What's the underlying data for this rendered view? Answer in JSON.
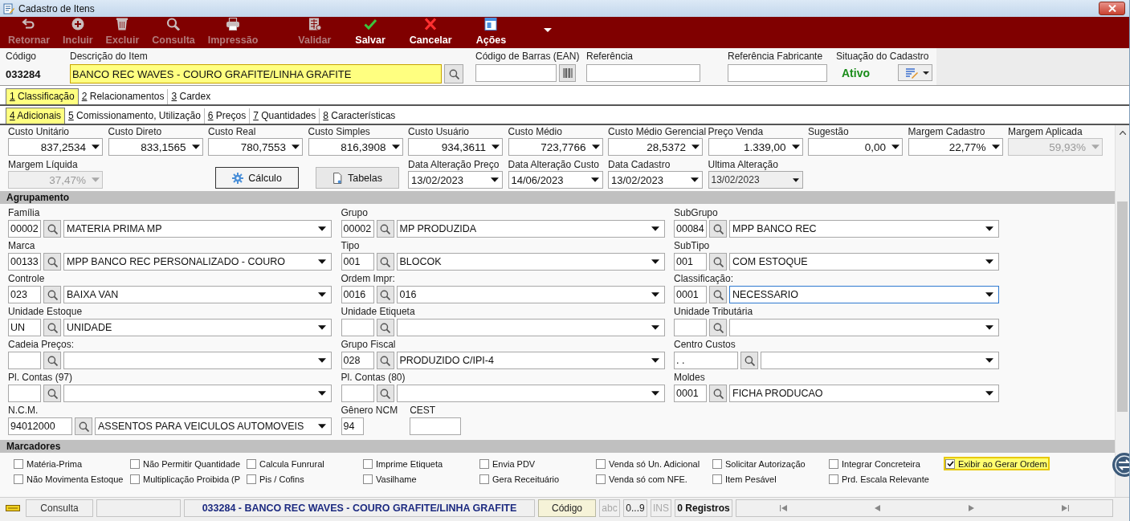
{
  "window": {
    "title": "Cadastro de Itens"
  },
  "toolbar": {
    "groups": [
      [
        {
          "label": "Retornar",
          "kind": "return",
          "disabled": true
        },
        {
          "label": "Incluir",
          "kind": "add",
          "disabled": true
        },
        {
          "label": "Excluir",
          "kind": "delete",
          "disabled": true
        },
        {
          "label": "Consulta",
          "kind": "search",
          "disabled": true
        },
        {
          "label": "Impressão",
          "kind": "print",
          "disabled": true
        }
      ],
      [
        {
          "label": "Validar",
          "kind": "validate",
          "disabled": true
        },
        {
          "label": "Salvar",
          "kind": "save",
          "disabled": false
        },
        {
          "label": "Cancelar",
          "kind": "cancel",
          "disabled": false
        },
        {
          "label": "Ações",
          "kind": "actions",
          "disabled": false
        }
      ]
    ]
  },
  "header": {
    "code": {
      "label": "Código",
      "value": "033284"
    },
    "description": {
      "label": "Descrição do Item",
      "value": "BANCO REC WAVES - COURO GRAFITE/LINHA GRAFITE",
      "highlighted": true
    },
    "barcode": {
      "label": "Código de Barras (EAN)"
    },
    "reference": {
      "label": "Referência"
    },
    "manufacturer_reference": {
      "label": "Referência Fabricante"
    },
    "status": {
      "label": "Situação do Cadastro",
      "value": "Ativo"
    }
  },
  "tabs": [
    {
      "key": "1",
      "label": "Classificação",
      "selected": true
    },
    {
      "key": "2",
      "label": "Relacionamentos",
      "selected": false
    },
    {
      "key": "3",
      "label": "Cardex",
      "selected": false
    }
  ],
  "subtabs": [
    {
      "key": "4",
      "label": "Adicionais",
      "selected": true
    },
    {
      "key": "5",
      "label": "Comissionamento, Utilização",
      "selected": false
    },
    {
      "key": "6",
      "label": "Preços",
      "selected": false
    },
    {
      "key": "7",
      "label": "Quantidades",
      "selected": false
    },
    {
      "key": "8",
      "label": "Características",
      "selected": false
    }
  ],
  "prices": [
    {
      "label": "Custo Unitário",
      "value": "837,2534",
      "disabled": false
    },
    {
      "label": "Custo Direto",
      "value": "833,1565",
      "disabled": false
    },
    {
      "label": "Custo Real",
      "value": "780,7553",
      "disabled": false
    },
    {
      "label": "Custo Simples",
      "value": "816,3908",
      "disabled": false
    },
    {
      "label": "Custo Usuário",
      "value": "934,3611",
      "disabled": false
    },
    {
      "label": "Custo Médio",
      "value": "723,7766",
      "disabled": false
    },
    {
      "label": "Custo Médio Gerencial",
      "value": "28,5372",
      "disabled": false
    },
    {
      "label": "Preço Venda",
      "value": "1.339,00",
      "disabled": false
    },
    {
      "label": "Sugestão",
      "value": "0,00",
      "disabled": false
    },
    {
      "label": "Margem Cadastro",
      "value": "22,77%",
      "disabled": false
    },
    {
      "label": "Margem Aplicada",
      "value": "59,93%",
      "disabled": true
    }
  ],
  "margin": {
    "label": "Margem Líquida",
    "value": "37,47%",
    "disabled": true
  },
  "actions": [
    {
      "label": "Cálculo",
      "kind": "calc",
      "default": true
    },
    {
      "label": "Tabelas",
      "kind": "tables",
      "default": false
    }
  ],
  "dates": [
    {
      "label": "Data Alteração Preço",
      "value": "13/02/2023",
      "disabled": false
    },
    {
      "label": "Data Alteração Custo",
      "value": "14/06/2023",
      "disabled": false
    },
    {
      "label": "Data Cadastro",
      "value": "13/02/2023",
      "disabled": false
    },
    {
      "label": "Ultima Alteração",
      "value": "13/02/2023",
      "disabled": true
    }
  ],
  "grouping": {
    "title": "Agrupamento",
    "rows": [
      [
        {
          "label": "Família",
          "kind": "lookup",
          "code": "00002",
          "value": "MATERIA PRIMA MP",
          "focused": false
        },
        {
          "label": "Grupo",
          "kind": "lookup",
          "code": "00002",
          "value": "MP PRODUZIDA",
          "focused": false
        },
        {
          "label": "SubGrupo",
          "kind": "lookup",
          "code": "00084",
          "value": "MPP BANCO REC",
          "focused": false
        }
      ],
      [
        {
          "label": "Marca",
          "kind": "lookup",
          "code": "00133",
          "value": "MPP BANCO REC PERSONALIZADO - COURO",
          "focused": false
        },
        {
          "label": "Tipo",
          "kind": "lookup",
          "code": "001",
          "value": "BLOCOK",
          "focused": false
        },
        {
          "label": "SubTipo",
          "kind": "lookup",
          "code": "001",
          "value": "COM ESTOQUE",
          "focused": false
        }
      ],
      [
        {
          "label": "Controle",
          "kind": "lookup",
          "code": "023",
          "value": "BAIXA VAN",
          "focused": false
        },
        {
          "label": "Ordem Impr:",
          "kind": "lookup",
          "code": "0016",
          "value": "016",
          "focused": false
        },
        {
          "label": "Classificação:",
          "kind": "lookup",
          "code": "0001",
          "value": "NECESSARIO",
          "focused": true
        }
      ],
      [
        {
          "label": "Unidade Estoque",
          "kind": "lookup",
          "code": "UN",
          "value": "UNIDADE",
          "focused": false
        },
        {
          "label": "Unidade Etiqueta",
          "kind": "lookup",
          "focused": false
        },
        {
          "label": "Unidade Tributária",
          "kind": "lookup",
          "focused": false
        }
      ],
      [
        {
          "label": "Cadeia Preços:",
          "kind": "lookup",
          "focused": false
        },
        {
          "label": "Grupo Fiscal",
          "kind": "lookup",
          "code": "028",
          "value": "PRODUZIDO C/IPI-4",
          "focused": false
        },
        {
          "label": "Centro Custos",
          "kind": "widelookup",
          "code": ".  .",
          "focused": false
        }
      ],
      [
        {
          "label": "Pl. Contas (97)",
          "kind": "lookup",
          "focused": false
        },
        {
          "label": "Pl. Contas (80)",
          "kind": "lookup",
          "focused": false
        },
        {
          "label": "Moldes",
          "kind": "lookup",
          "code": "0001",
          "value": "FICHA PRODUCAO",
          "focused": false
        }
      ],
      [
        {
          "label": "N.C.M.",
          "kind": "widelookup",
          "code": "94012000",
          "value": "ASSENTOS PARA VEICULOS AUTOMOVEIS",
          "focused": false
        },
        {
          "label": "Gênero NCM",
          "kind": "box",
          "code": "94",
          "focused": false
        },
        {
          "label": "CEST",
          "kind": "box",
          "focused": false
        }
      ]
    ]
  },
  "markers": {
    "title": "Marcadores",
    "items": [
      {
        "label": "Matéria-Prima",
        "checked": false,
        "highlighted": false
      },
      {
        "label": "Não Permitir Quantidade",
        "checked": false,
        "highlighted": false
      },
      {
        "label": "Calcula Funrural",
        "checked": false,
        "highlighted": false
      },
      {
        "label": "Imprime Etiqueta",
        "checked": false,
        "highlighted": false
      },
      {
        "label": "Envia PDV",
        "checked": false,
        "highlighted": false
      },
      {
        "label": "Venda só Un. Adicional",
        "checked": false,
        "highlighted": false
      },
      {
        "label": "Solicitar Autorização",
        "checked": false,
        "highlighted": false
      },
      {
        "label": "Integrar Concreteira",
        "checked": false,
        "highlighted": false
      },
      {
        "label": "Exibir ao Gerar Ordem",
        "checked": true,
        "highlighted": true
      },
      {
        "label": "Não Movimenta Estoque",
        "checked": false,
        "highlighted": false
      },
      {
        "label": "Multiplicação Proibida (P",
        "checked": false,
        "highlighted": false
      },
      {
        "label": "Pis / Cofins",
        "checked": false,
        "highlighted": false
      },
      {
        "label": "Vasilhame",
        "checked": false,
        "highlighted": false
      },
      {
        "label": "Gera Receituário",
        "checked": false,
        "highlighted": false
      },
      {
        "label": "Venda só com NFE.",
        "checked": false,
        "highlighted": false
      },
      {
        "label": "Item Pesável",
        "checked": false,
        "highlighted": false
      },
      {
        "label": "Prd. Escala Relevante",
        "checked": false,
        "highlighted": false
      }
    ]
  },
  "status_bar": {
    "mode": "Consulta",
    "record": "033284 - BANCO REC WAVES - COURO GRAFITE/LINHA GRAFITE",
    "sort": "Código",
    "indicators": [
      {
        "label": "abc",
        "on": false
      },
      {
        "label": "0...9",
        "on": true
      },
      {
        "label": "INS",
        "on": false
      }
    ],
    "count": "0 Registros"
  }
}
